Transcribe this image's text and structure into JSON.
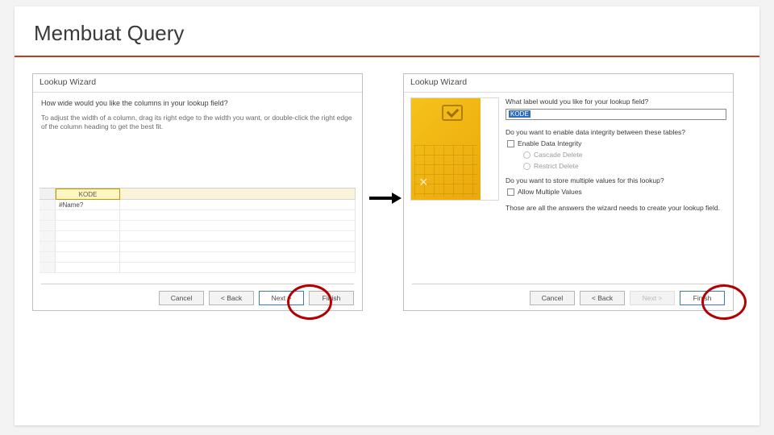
{
  "title": "Membuat Query",
  "dialog_left": {
    "title": "Lookup Wizard",
    "question": "How wide would you like the columns in your lookup field?",
    "hint": "To adjust the width of a column, drag its right edge to the width you want, or double-click the right edge of the column heading to get the best fit.",
    "col_header": "KODE",
    "row1": "#Name?",
    "buttons": {
      "cancel": "Cancel",
      "back": "< Back",
      "next": "Next >",
      "finish": "Finish"
    }
  },
  "dialog_right": {
    "title": "Lookup Wizard",
    "q_label": "What label would you like for your lookup field?",
    "label_value": "KODE",
    "q_integrity": "Do you want to enable data integrity between these tables?",
    "chk_integrity": "Enable Data Integrity",
    "opt_cascade": "Cascade Delete",
    "opt_restrict": "Restrict Delete",
    "q_multi": "Do you want to store multiple values for this lookup?",
    "chk_multi": "Allow Multiple Values",
    "final": "Those are all the answers the wizard needs to create your lookup field.",
    "buttons": {
      "cancel": "Cancel",
      "back": "< Back",
      "next": "Next >",
      "finish": "Finish"
    }
  }
}
